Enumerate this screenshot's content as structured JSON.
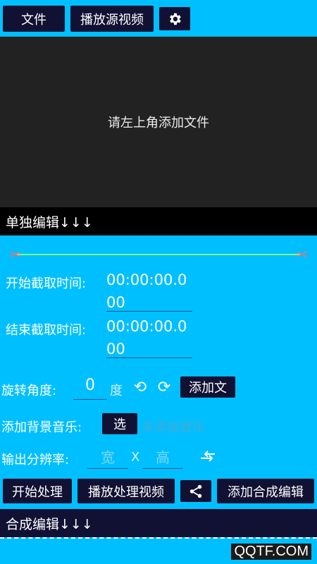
{
  "toolbar": {
    "file_label": "文件",
    "play_source_label": "播放源视频",
    "settings_icon": "gear-icon"
  },
  "preview": {
    "message": "请左上角添加文件"
  },
  "single_edit": {
    "title": "单独编辑↓↓↓"
  },
  "trim": {
    "start_label": "开始截取时间:",
    "start_value": "00:00:00.000",
    "end_label": "结束截取时间:",
    "end_value": "00:00:00.000"
  },
  "rotation": {
    "label": "旋转角度:",
    "value": "0",
    "unit": "度",
    "add_text_label": "添加文"
  },
  "music": {
    "label": "添加背景音乐:",
    "select_label": "选",
    "status": "未添加音乐"
  },
  "resolution": {
    "label": "输出分辨率:",
    "width_placeholder": "宽",
    "separator": "X",
    "height_placeholder": "高"
  },
  "actions": {
    "start_label": "开始处理",
    "play_processed_label": "播放处理视频",
    "share_icon": "share-icon",
    "add_merge_label": "添加合成编辑"
  },
  "merge_edit": {
    "title": "合成编辑↓↓↓"
  },
  "watermark": {
    "text": "QQTF.COM"
  },
  "colors": {
    "background": "#00BFFF",
    "button": "#111133",
    "preview": "#222222",
    "bar": "#000000",
    "range_line": "#7CFC7C"
  }
}
